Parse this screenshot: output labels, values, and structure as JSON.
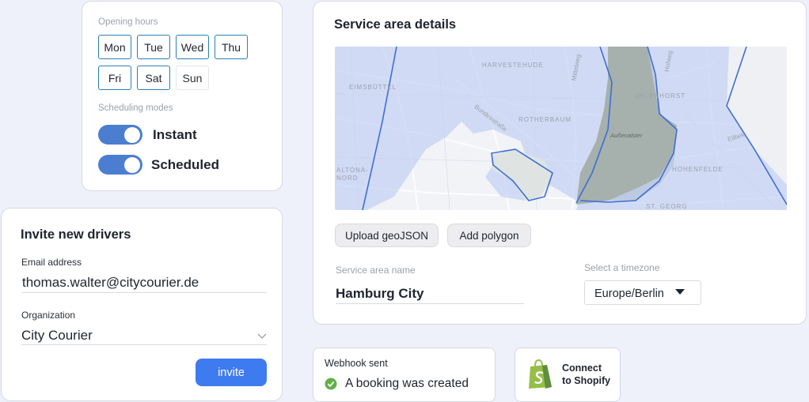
{
  "opening_hours": {
    "label": "Opening hours",
    "days": [
      {
        "label": "Mon",
        "active": true
      },
      {
        "label": "Tue",
        "active": true
      },
      {
        "label": "Wed",
        "active": true
      },
      {
        "label": "Thu",
        "active": true
      },
      {
        "label": "Fri",
        "active": true
      },
      {
        "label": "Sat",
        "active": true
      },
      {
        "label": "Sun",
        "active": false
      }
    ],
    "modes_label": "Scheduling modes",
    "modes": [
      {
        "label": "Instant",
        "enabled": true
      },
      {
        "label": "Scheduled",
        "enabled": true
      }
    ]
  },
  "invite": {
    "title": "Invite new drivers",
    "email_label": "Email address",
    "email_value": "thomas.walter@citycourier.de",
    "org_label": "Organization",
    "org_value": "City Courier",
    "invite_button": "invite"
  },
  "service_area": {
    "title": "Service area details",
    "map_labels": {
      "harvestehude": "HARVESTEHUDE",
      "eimsbuttel": "EIMSBÜTTEL",
      "rotherbaum": "ROTHERBAUM",
      "bundesstrasse": "Bundesstraße",
      "milchstrasse": "Mittelweg",
      "uhlenhorst": "UHLENHORST",
      "aussenalster": "Außenalster",
      "altona": "ALTONA-",
      "altona2": "NORD",
      "hohenfelde": "HOHENFELDE",
      "stgeorg": "ST. GEORG",
      "eilbek": "Eilbek",
      "hofweg": "Hofweg"
    },
    "upload_button": "Upload geoJSON",
    "polygon_button": "Add polygon",
    "name_label": "Service area name",
    "name_value": "Hamburg City",
    "timezone_label": "Select a timezone",
    "timezone_value": "Europe/Berlin"
  },
  "webhook": {
    "label": "Webhook sent",
    "message": "A booking was created"
  },
  "shopify": {
    "line1": "Connect",
    "line2": "to Shopify"
  },
  "colors": {
    "accent": "#3f7bf0",
    "toggle": "#4b7ed0",
    "day_border": "#2a7fb8",
    "success": "#62b049",
    "shopify": "#95bf47"
  }
}
